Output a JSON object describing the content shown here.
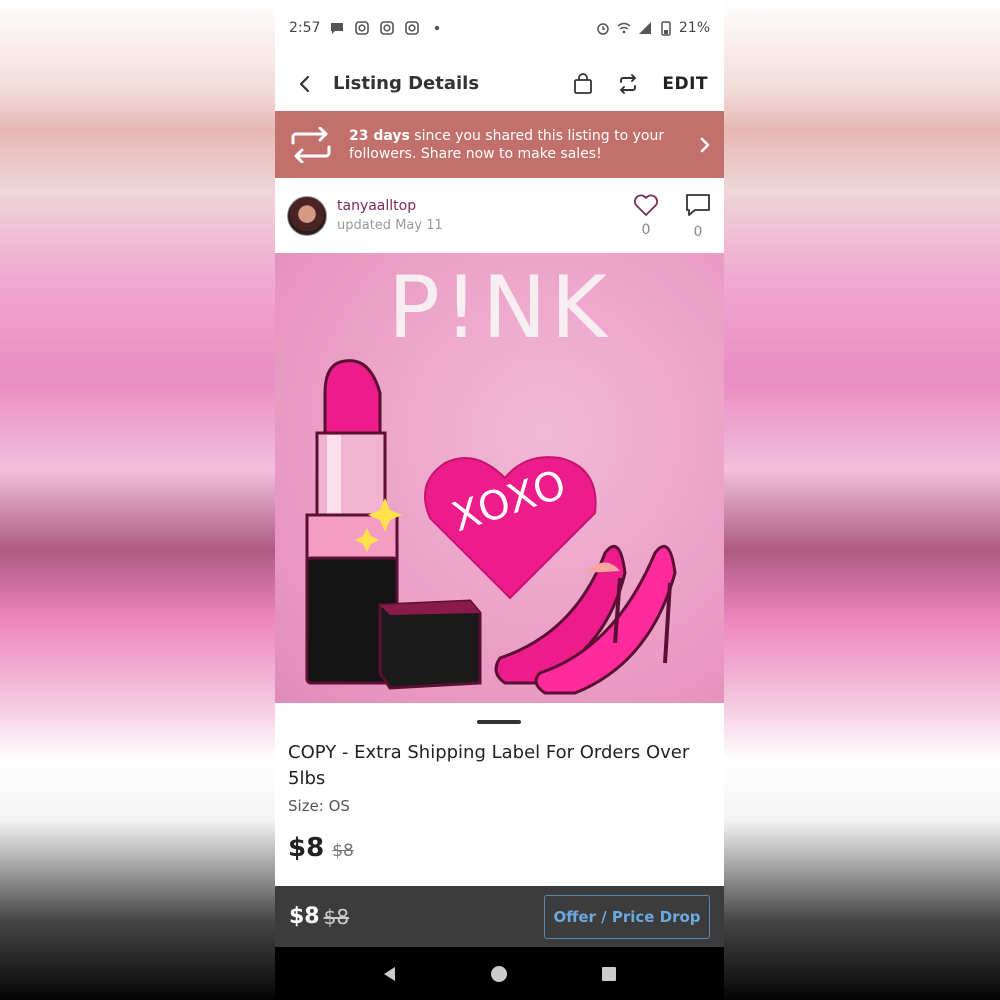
{
  "status_bar": {
    "time": "2:57",
    "battery": "21%"
  },
  "header": {
    "title": "Listing Details",
    "edit_label": "EDIT"
  },
  "share_banner": {
    "days": "23 days",
    "message": " since you shared this listing to your followers. Share now to make sales!"
  },
  "seller": {
    "username": "tanyaalltop",
    "updated": "updated May 11",
    "likes": "0",
    "comments": "0"
  },
  "listing_image": {
    "title_text": "P!NK",
    "heart_text": "XOXO"
  },
  "product": {
    "title": "COPY - Extra Shipping Label For Orders Over 5lbs",
    "size": "Size: OS",
    "price": "$8",
    "original_price": "$8"
  },
  "buy_bar": {
    "price": "$8",
    "original_price": "$8",
    "offer_label": "Offer / Price Drop"
  },
  "colors": {
    "banner": "#c2706b",
    "accent_pink": "#ec1c8b",
    "offer_blue": "#6aa9df"
  }
}
